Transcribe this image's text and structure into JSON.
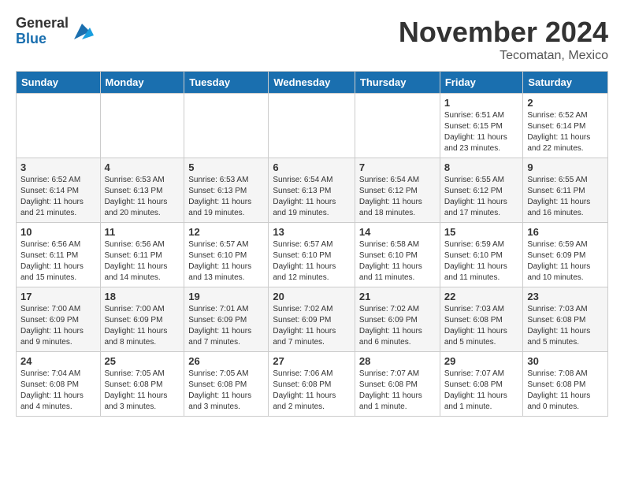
{
  "logo": {
    "general": "General",
    "blue": "Blue"
  },
  "title": "November 2024",
  "location": "Tecomatan, Mexico",
  "days_of_week": [
    "Sunday",
    "Monday",
    "Tuesday",
    "Wednesday",
    "Thursday",
    "Friday",
    "Saturday"
  ],
  "weeks": [
    [
      {
        "day": "",
        "info": ""
      },
      {
        "day": "",
        "info": ""
      },
      {
        "day": "",
        "info": ""
      },
      {
        "day": "",
        "info": ""
      },
      {
        "day": "",
        "info": ""
      },
      {
        "day": "1",
        "info": "Sunrise: 6:51 AM\nSunset: 6:15 PM\nDaylight: 11 hours and 23 minutes."
      },
      {
        "day": "2",
        "info": "Sunrise: 6:52 AM\nSunset: 6:14 PM\nDaylight: 11 hours and 22 minutes."
      }
    ],
    [
      {
        "day": "3",
        "info": "Sunrise: 6:52 AM\nSunset: 6:14 PM\nDaylight: 11 hours and 21 minutes."
      },
      {
        "day": "4",
        "info": "Sunrise: 6:53 AM\nSunset: 6:13 PM\nDaylight: 11 hours and 20 minutes."
      },
      {
        "day": "5",
        "info": "Sunrise: 6:53 AM\nSunset: 6:13 PM\nDaylight: 11 hours and 19 minutes."
      },
      {
        "day": "6",
        "info": "Sunrise: 6:54 AM\nSunset: 6:13 PM\nDaylight: 11 hours and 19 minutes."
      },
      {
        "day": "7",
        "info": "Sunrise: 6:54 AM\nSunset: 6:12 PM\nDaylight: 11 hours and 18 minutes."
      },
      {
        "day": "8",
        "info": "Sunrise: 6:55 AM\nSunset: 6:12 PM\nDaylight: 11 hours and 17 minutes."
      },
      {
        "day": "9",
        "info": "Sunrise: 6:55 AM\nSunset: 6:11 PM\nDaylight: 11 hours and 16 minutes."
      }
    ],
    [
      {
        "day": "10",
        "info": "Sunrise: 6:56 AM\nSunset: 6:11 PM\nDaylight: 11 hours and 15 minutes."
      },
      {
        "day": "11",
        "info": "Sunrise: 6:56 AM\nSunset: 6:11 PM\nDaylight: 11 hours and 14 minutes."
      },
      {
        "day": "12",
        "info": "Sunrise: 6:57 AM\nSunset: 6:10 PM\nDaylight: 11 hours and 13 minutes."
      },
      {
        "day": "13",
        "info": "Sunrise: 6:57 AM\nSunset: 6:10 PM\nDaylight: 11 hours and 12 minutes."
      },
      {
        "day": "14",
        "info": "Sunrise: 6:58 AM\nSunset: 6:10 PM\nDaylight: 11 hours and 11 minutes."
      },
      {
        "day": "15",
        "info": "Sunrise: 6:59 AM\nSunset: 6:10 PM\nDaylight: 11 hours and 11 minutes."
      },
      {
        "day": "16",
        "info": "Sunrise: 6:59 AM\nSunset: 6:09 PM\nDaylight: 11 hours and 10 minutes."
      }
    ],
    [
      {
        "day": "17",
        "info": "Sunrise: 7:00 AM\nSunset: 6:09 PM\nDaylight: 11 hours and 9 minutes."
      },
      {
        "day": "18",
        "info": "Sunrise: 7:00 AM\nSunset: 6:09 PM\nDaylight: 11 hours and 8 minutes."
      },
      {
        "day": "19",
        "info": "Sunrise: 7:01 AM\nSunset: 6:09 PM\nDaylight: 11 hours and 7 minutes."
      },
      {
        "day": "20",
        "info": "Sunrise: 7:02 AM\nSunset: 6:09 PM\nDaylight: 11 hours and 7 minutes."
      },
      {
        "day": "21",
        "info": "Sunrise: 7:02 AM\nSunset: 6:09 PM\nDaylight: 11 hours and 6 minutes."
      },
      {
        "day": "22",
        "info": "Sunrise: 7:03 AM\nSunset: 6:08 PM\nDaylight: 11 hours and 5 minutes."
      },
      {
        "day": "23",
        "info": "Sunrise: 7:03 AM\nSunset: 6:08 PM\nDaylight: 11 hours and 5 minutes."
      }
    ],
    [
      {
        "day": "24",
        "info": "Sunrise: 7:04 AM\nSunset: 6:08 PM\nDaylight: 11 hours and 4 minutes."
      },
      {
        "day": "25",
        "info": "Sunrise: 7:05 AM\nSunset: 6:08 PM\nDaylight: 11 hours and 3 minutes."
      },
      {
        "day": "26",
        "info": "Sunrise: 7:05 AM\nSunset: 6:08 PM\nDaylight: 11 hours and 3 minutes."
      },
      {
        "day": "27",
        "info": "Sunrise: 7:06 AM\nSunset: 6:08 PM\nDaylight: 11 hours and 2 minutes."
      },
      {
        "day": "28",
        "info": "Sunrise: 7:07 AM\nSunset: 6:08 PM\nDaylight: 11 hours and 1 minute."
      },
      {
        "day": "29",
        "info": "Sunrise: 7:07 AM\nSunset: 6:08 PM\nDaylight: 11 hours and 1 minute."
      },
      {
        "day": "30",
        "info": "Sunrise: 7:08 AM\nSunset: 6:08 PM\nDaylight: 11 hours and 0 minutes."
      }
    ]
  ]
}
